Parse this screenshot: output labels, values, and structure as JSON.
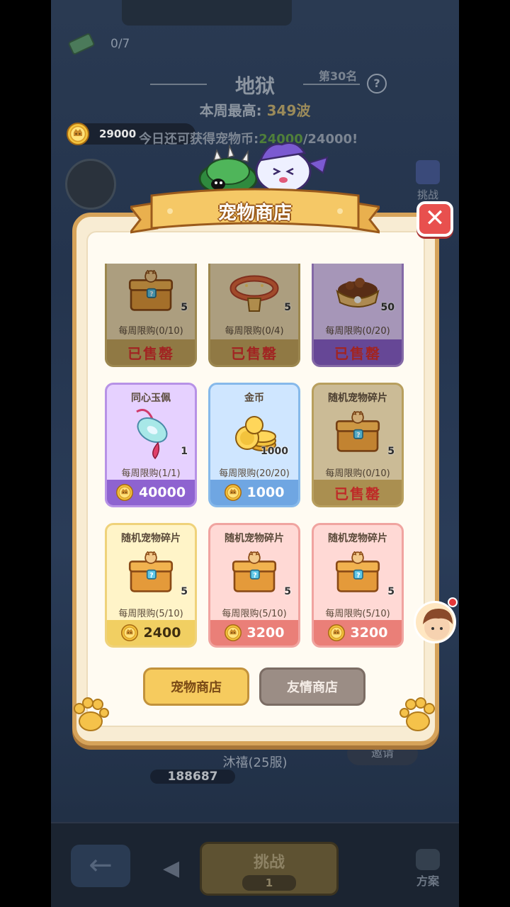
{
  "hud": {
    "tickets": "0/7",
    "stage_title": "地狱",
    "stage_rank": "第30名",
    "help": "?",
    "week_best_label": "本周最高:",
    "week_best_value": "349波",
    "coins": "29000",
    "daily_prefix": "今日还可获得宠物币:",
    "daily_current": "24000",
    "daily_suffix": "/24000!",
    "side_challenge": "挑战",
    "player_name": "沐禧(25服)",
    "player_power": "188687",
    "invite": "邀请",
    "back_arrow": "←",
    "prev_arrow": "◀",
    "challenge_label": "挑战",
    "challenge_cost": "1",
    "plan_label": "方案"
  },
  "shop": {
    "title": "宠物商店",
    "close": "✕",
    "sold_out": "已售罄",
    "items": [
      {
        "name": "",
        "qty": "5",
        "limit": "每周限购(0/10)",
        "price": "",
        "sold": true
      },
      {
        "name": "",
        "qty": "5",
        "limit": "每周限购(0/4)",
        "price": "",
        "sold": true
      },
      {
        "name": "",
        "qty": "50",
        "limit": "每周限购(0/20)",
        "price": "",
        "sold": true
      },
      {
        "name": "同心玉佩",
        "qty": "1",
        "limit": "每周限购(1/1)",
        "price": "40000",
        "sold": false
      },
      {
        "name": "金币",
        "qty": "1000",
        "limit": "每周限购(20/20)",
        "price": "1000",
        "sold": false
      },
      {
        "name": "随机宠物碎片",
        "qty": "5",
        "limit": "每周限购(0/10)",
        "price": "",
        "sold": true
      },
      {
        "name": "随机宠物碎片",
        "qty": "5",
        "limit": "每周限购(5/10)",
        "price": "2400",
        "sold": false
      },
      {
        "name": "随机宠物碎片",
        "qty": "5",
        "limit": "每周限购(5/10)",
        "price": "3200",
        "sold": false
      },
      {
        "name": "随机宠物碎片",
        "qty": "5",
        "limit": "每周限购(5/10)",
        "price": "3200",
        "sold": false
      }
    ],
    "tab_pet": "宠物商店",
    "tab_friend": "友情商店"
  },
  "colors": {
    "sold_text": "#e0322f",
    "modal_border": "#d6a35a",
    "close_red": "#e8504e"
  },
  "icons": [
    "coin-icon",
    "chest-icon",
    "collar-icon",
    "food-bowl-icon",
    "jade-pendant-icon",
    "gold-coins-icon",
    "paw-icon",
    "close-icon"
  ]
}
